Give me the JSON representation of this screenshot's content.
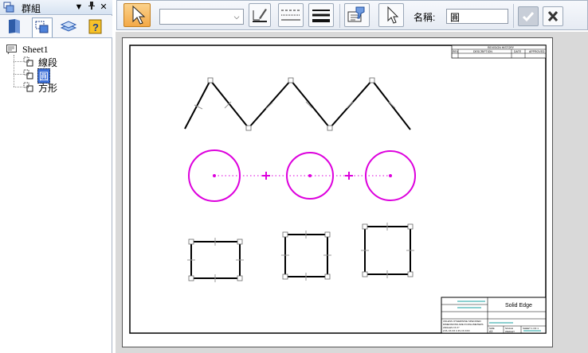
{
  "panel": {
    "title": "群組",
    "controls": {
      "dropdown": "▼",
      "pin": "ꟷ",
      "close": "✕"
    },
    "tabs": [
      "tab-parts",
      "tab-groups",
      "tab-layers",
      "tab-help"
    ],
    "tree": {
      "root": "Sheet1",
      "items": [
        {
          "label": "線段",
          "selected": false
        },
        {
          "label": "圓",
          "selected": true
        },
        {
          "label": "方形",
          "selected": false
        }
      ]
    }
  },
  "toolbar": {
    "linestyle_value": "",
    "name_label": "名稱:",
    "name_value": "圓",
    "accent": "#f3a948"
  },
  "title_block": {
    "company": "Solid Edge",
    "revision_header": "REVISION HISTORY",
    "columns": [
      "REV",
      "DESCRIPTION",
      "DATE",
      "APPROVED"
    ],
    "notes": [
      "UNLESS OTHERWISE SPECIFIED",
      "DIMENSIONS ARE IN MILLIMETERS",
      "ANGLES ±X.X°",
      "2 PL ±X.XX 3 PL ±X.XXX"
    ],
    "size_label": "SIZE",
    "size_value": "A3",
    "scale_label": "SCALE",
    "weight_label": "WEIGHT",
    "sheet_label": "SHEET 1 OF 1"
  },
  "colors": {
    "circle": "#dd00dd",
    "geometry": "#000000",
    "handle": "#888888",
    "selection": "#3c6fd8"
  }
}
